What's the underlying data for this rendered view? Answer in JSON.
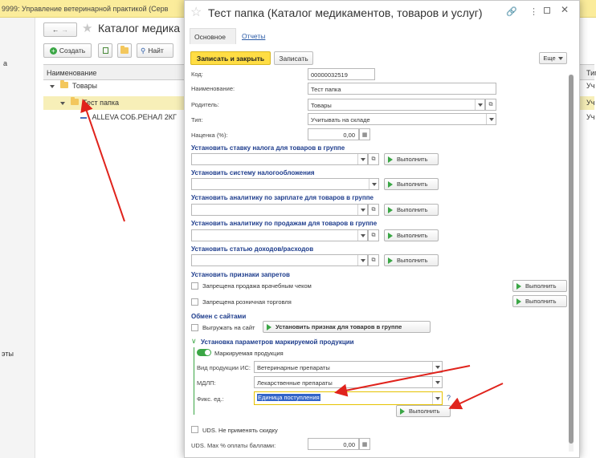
{
  "app": {
    "title": "9999: Управление ветеринарной практикой (Серв",
    "side_texts": [
      "а",
      "эты"
    ]
  },
  "catalog": {
    "title": "Каталог медика",
    "create_label": "Создать",
    "find_label": "Найт",
    "col_name": "Наименование",
    "col_type": "Тип",
    "rows": [
      {
        "label": "Товары",
        "type": "Уч"
      },
      {
        "label": "Тест папка",
        "type": "Уч"
      },
      {
        "label": "ALLEVA СОБ.РЕНАЛ 2КГ",
        "type": "Уч"
      }
    ]
  },
  "dialog": {
    "title": "Тест папка (Каталог медикаментов, товаров и услуг)",
    "tabs": [
      "Основное",
      "Отчеты"
    ],
    "save_close_label": "Записать и закрыть",
    "save_label": "Записать",
    "more_label": "Еще",
    "code_label": "Код:",
    "code_value": "00000032519",
    "name_label": "Наименование:",
    "name_value": "Тест папка",
    "parent_label": "Родитель:",
    "parent_value": "Товары",
    "type_label": "Тип:",
    "type_value": "Учитывать на складе",
    "markup_label": "Наценка (%):",
    "markup_value": "0,00",
    "run_label": "Выполнить",
    "sections": [
      "Установить ставку налога для товаров в группе",
      "Установить систему налогообложения",
      "Установить аналитику по зарплате для товаров в группе",
      "Установить аналитику по продажам для товаров в группе",
      "Установить статью доходов/расходов"
    ],
    "bans_header": "Установить признаки запретов",
    "ban_vet_label": "Запрещена продажа врачебным чеком",
    "ban_retail_label": "Запрещена розничная торговля",
    "sites_header": "Обмен с сайтами",
    "upload_label": "Выгружать на сайт",
    "set_group_label": "Установить признак для товаров в группе",
    "marking_header": "Установка параметров маркируемой продукции",
    "marked_label": "Маркируемая продукция",
    "kind_label": "Вид продукции ИС:",
    "kind_value": "Ветеринарные препараты",
    "mdlp_label": "МДЛП:",
    "mdlp_value": "Лекарственные препараты",
    "unit_label": "Фикс. ед.:",
    "unit_value": "Единица поступления",
    "help_mark": "?",
    "uds_label": "UDS. Не применять скидку",
    "uds_max_label": "UDS. Max % оплаты баллами:",
    "uds_max_value": "0,00"
  },
  "colors": {
    "accent": "#ffdd44",
    "header_blue": "#1d3c8c",
    "arrow": "#e0231c",
    "toggle": "#3aa645"
  }
}
